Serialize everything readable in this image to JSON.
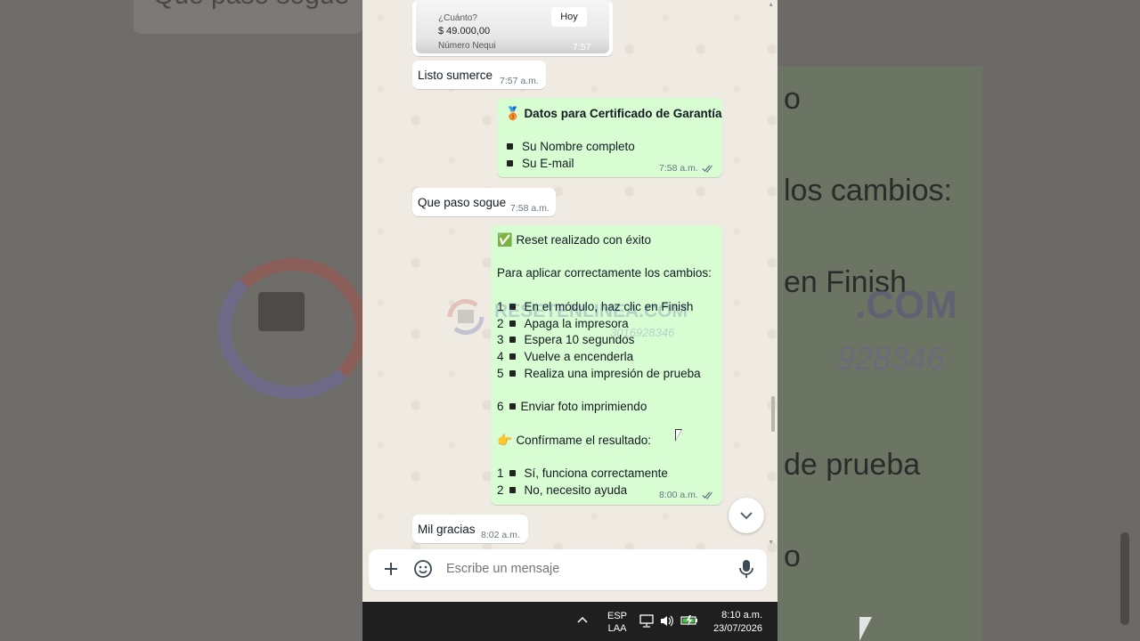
{
  "background": {
    "left_text": "Que paso sogue",
    "right_lines": [
      "o",
      "los cambios:",
      "en Finish",
      "de prueba",
      "o"
    ],
    "right_watermark": ".COM",
    "right_number": "928346"
  },
  "chat": {
    "payment_card": {
      "question": "¿Cuánto?",
      "amount": "$ 49.000,00",
      "when": "Hoy",
      "account_label": "Número Nequi",
      "time": "7:57 a.m."
    },
    "messages": [
      {
        "id": "m1",
        "dir": "in",
        "text": "Listo sumerce",
        "time": "7:57 a.m."
      },
      {
        "id": "m2",
        "dir": "out",
        "title_emoji": "🥉",
        "title": "Datos para Certificado de Garantía",
        "items": [
          "Su Nombre completo",
          "Su E-mail"
        ],
        "time": "7:58 a.m."
      },
      {
        "id": "m3",
        "dir": "in",
        "text": "Que paso sogue",
        "time": "7:58 a.m."
      },
      {
        "id": "m4",
        "dir": "out",
        "header_emoji": "✅",
        "header": "Reset realizado con éxito",
        "intro": "Para aplicar correctamente los cambios:",
        "steps": [
          {
            "num": "1",
            "text": "En el módulo, haz clic en Finish"
          },
          {
            "num": "2",
            "text": "Apaga la impresora"
          },
          {
            "num": "3",
            "text": "Espera 10 segundos"
          },
          {
            "num": "4",
            "text": "Vuelve a encenderla"
          },
          {
            "num": "5",
            "text": "Realiza una impresión de prueba"
          }
        ],
        "step6": {
          "num": "6",
          "text": "Enviar foto imprimiendo"
        },
        "confirm_emoji": "👉",
        "confirm": "Confírmame el resultado:",
        "options": [
          {
            "num": "1",
            "text": "Sí, funciona correctamente"
          },
          {
            "num": "2",
            "text": "No, necesito ayuda"
          }
        ],
        "time": "8:00 a.m."
      },
      {
        "id": "m5",
        "dir": "in",
        "text": "Mil gracias",
        "time": "8:02 a.m."
      }
    ],
    "watermark": {
      "brand": "RESETENLINEA.COM",
      "phone": "3016928346"
    }
  },
  "composer": {
    "placeholder": "Escribe un mensaje"
  },
  "taskbar": {
    "lang_top": "ESP",
    "lang_bottom": "LAA",
    "clock_time": "8:10 a.m.",
    "clock_date": "23/07/2026"
  },
  "colors": {
    "incoming": "#ffffff",
    "outgoing": "#d9fdd3",
    "chat_bg": "#efeae2",
    "taskbar": "#1f1f1f",
    "tick": "#667781"
  }
}
